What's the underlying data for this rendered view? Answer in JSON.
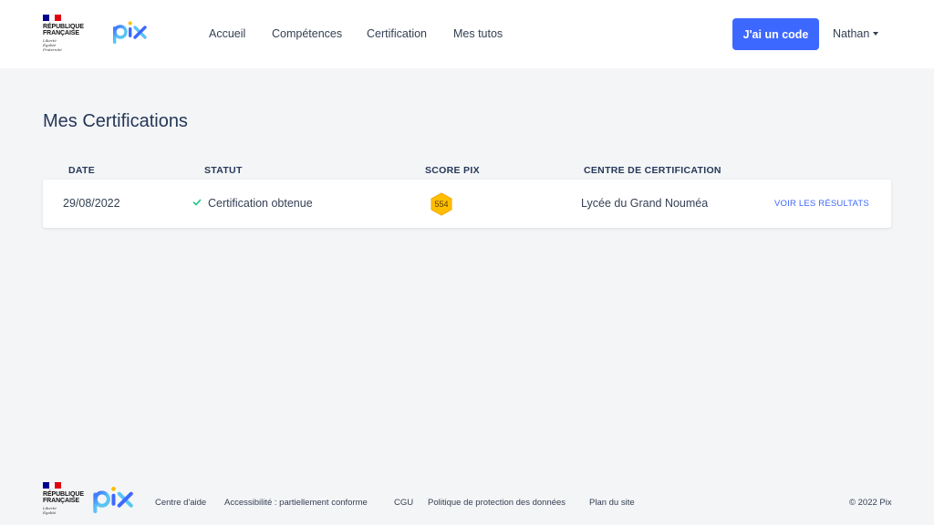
{
  "header": {
    "gov_logo": {
      "flag_colors": [
        "#000091",
        "#ffffff",
        "#e1000f"
      ],
      "name_line1": "RÉPUBLIQUE",
      "name_line2": "FRANÇAISE",
      "motto_line1": "Liberté",
      "motto_line2": "Égalité",
      "motto_line3": "Fraternité"
    },
    "pix_logo_text": "pix",
    "nav": [
      {
        "label": "Accueil"
      },
      {
        "label": "Compétences"
      },
      {
        "label": "Certification"
      },
      {
        "label": "Mes tutos"
      }
    ],
    "code_button": "J'ai un code",
    "user_name": "Nathan"
  },
  "main": {
    "title": "Mes Certifications",
    "columns": [
      "DATE",
      "STATUT",
      "SCORE PIX",
      "CENTRE DE CERTIFICATION"
    ],
    "rows": [
      {
        "date": "29/08/2022",
        "status": "Certification obtenue",
        "score": "554",
        "centre": "Lycée du Grand Nouméa",
        "link": "VOIR LES RÉSULTATS"
      }
    ]
  },
  "footer": {
    "gov_logo": {
      "name_line1": "RÉPUBLIQUE",
      "name_line2": "FRANÇAISE",
      "motto_line1": "Liberté",
      "motto_line2": "Égalité",
      "motto_line3": "Fraternité"
    },
    "pix_logo_text": "pix",
    "links": [
      {
        "label": "Centre d'aide"
      },
      {
        "label": "Accessibilité : partiellement conforme"
      },
      {
        "label": "CGU"
      },
      {
        "label": "Politique de protection des données"
      },
      {
        "label": "Plan du site"
      }
    ],
    "copyright": "© 2022 Pix"
  },
  "colors": {
    "primary": "#3d68ff",
    "success": "#13c782",
    "score_badge": "#ffbe00",
    "background": "#f4f5f7"
  },
  "icons": [
    "check-icon",
    "caret-down-icon",
    "hexagon-score-icon"
  ]
}
